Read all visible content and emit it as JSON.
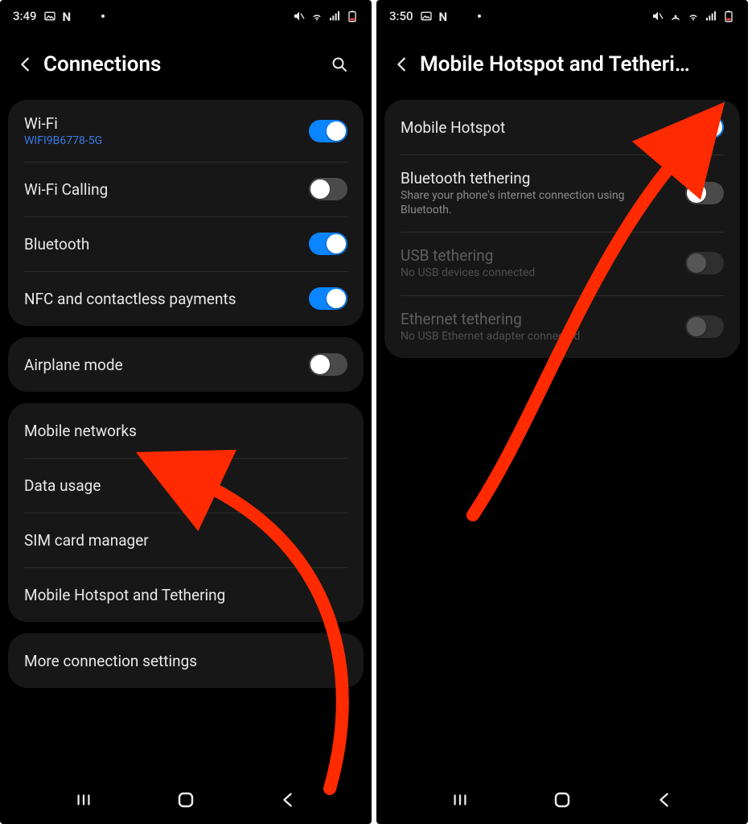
{
  "left": {
    "status": {
      "time": "3:49",
      "icons": [
        "image-icon",
        "netflix-icon",
        "check-icon"
      ]
    },
    "header": {
      "title": "Connections"
    },
    "group1": {
      "wifi": {
        "title": "Wi-Fi",
        "network": "WIFI9B6778-5G",
        "on": true
      },
      "wificall": {
        "title": "Wi-Fi Calling",
        "on": false
      },
      "bt": {
        "title": "Bluetooth",
        "on": true
      },
      "nfc": {
        "title": "NFC and contactless payments",
        "on": true
      }
    },
    "group2": {
      "airplane": {
        "title": "Airplane mode",
        "on": false
      }
    },
    "group3": {
      "mobile": {
        "title": "Mobile networks"
      },
      "data": {
        "title": "Data usage"
      },
      "sim": {
        "title": "SIM card manager"
      },
      "hotspot": {
        "title": "Mobile Hotspot and Tethering"
      }
    },
    "group4": {
      "more": {
        "title": "More connection settings"
      }
    }
  },
  "right": {
    "status": {
      "time": "3:50",
      "icons": [
        "image-icon",
        "netflix-icon",
        "check-icon"
      ]
    },
    "header": {
      "title": "Mobile Hotspot and Tetheri…"
    },
    "group1": {
      "hotspot": {
        "title": "Mobile Hotspot",
        "on": true
      },
      "bttether": {
        "title": "Bluetooth tethering",
        "sub": "Share your phone's internet connection using Bluetooth.",
        "on": false
      },
      "usb": {
        "title": "USB tethering",
        "sub": "No USB devices connected",
        "on": false,
        "disabled": true
      },
      "eth": {
        "title": "Ethernet tethering",
        "sub": "No USB Ethernet adapter connected",
        "on": false,
        "disabled": true
      }
    }
  }
}
